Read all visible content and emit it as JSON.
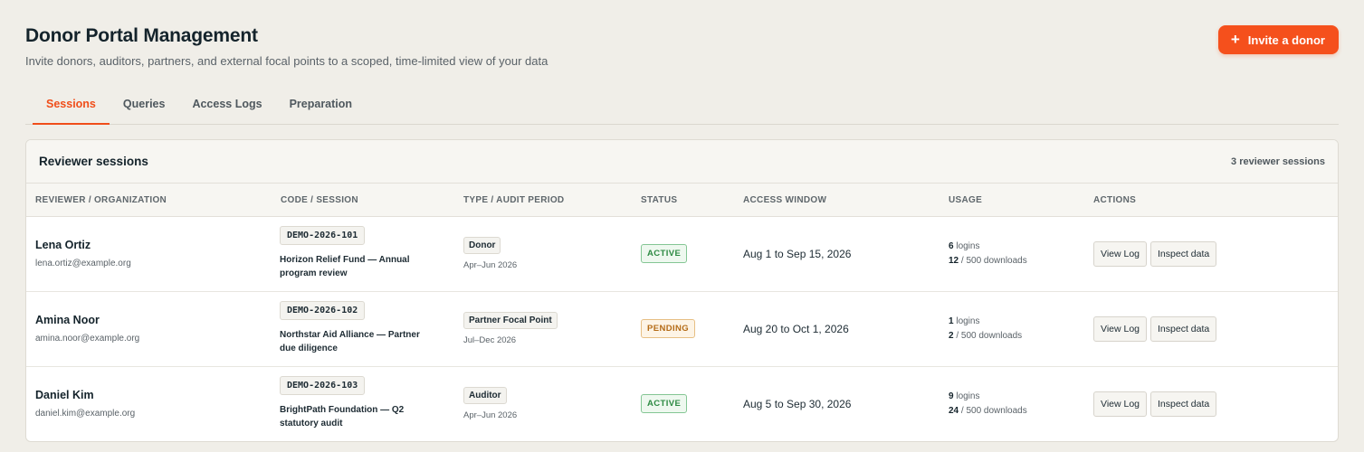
{
  "header": {
    "title": "Donor Portal Management",
    "subtitle": "Invite donors, auditors, partners, and external focal points to a scoped, time-limited view of your data",
    "invite_button": "Invite a donor",
    "invite_icon": "+"
  },
  "tabs": [
    {
      "label": "Sessions",
      "active": true
    },
    {
      "label": "Queries",
      "active": false
    },
    {
      "label": "Access Logs",
      "active": false
    },
    {
      "label": "Preparation",
      "active": false
    }
  ],
  "card": {
    "title": "Reviewer sessions",
    "count_text": "3 reviewer sessions"
  },
  "columns": {
    "reviewer": "REVIEWER / ORGANIZATION",
    "code": "CODE / SESSION",
    "type": "TYPE / AUDIT PERIOD",
    "status": "STATUS",
    "window": "ACCESS WINDOW",
    "usage": "USAGE",
    "actions": "ACTIONS"
  },
  "rows": [
    {
      "name": "Lena Ortiz",
      "email": "lena.ortiz@example.org",
      "code": "DEMO-2026-101",
      "session": "Horizon Relief Fund — Annual program review",
      "type": "Donor",
      "period": "Apr–Jun 2026",
      "status": "ACTIVE",
      "status_kind": "active",
      "window": "Aug 1 to Sep 15, 2026",
      "logins": "6",
      "logins_label": " logins",
      "downloads": "12",
      "downloads_label": " / 500 downloads",
      "action_view": "View Log",
      "action_inspect": "Inspect data"
    },
    {
      "name": "Amina Noor",
      "email": "amina.noor@example.org",
      "code": "DEMO-2026-102",
      "session": "Northstar Aid Alliance — Partner due diligence",
      "type": "Partner Focal Point",
      "period": "Jul–Dec 2026",
      "status": "PENDING",
      "status_kind": "pending",
      "window": "Aug 20 to Oct 1, 2026",
      "logins": "1",
      "logins_label": " logins",
      "downloads": "2",
      "downloads_label": " / 500 downloads",
      "action_view": "View Log",
      "action_inspect": "Inspect data"
    },
    {
      "name": "Daniel Kim",
      "email": "daniel.kim@example.org",
      "code": "DEMO-2026-103",
      "session": "BrightPath Foundation — Q2 statutory audit",
      "type": "Auditor",
      "period": "Apr–Jun 2026",
      "status": "ACTIVE",
      "status_kind": "active",
      "window": "Aug 5 to Sep 30, 2026",
      "logins": "9",
      "logins_label": " logins",
      "downloads": "24",
      "downloads_label": " / 500 downloads",
      "action_view": "View Log",
      "action_inspect": "Inspect data"
    }
  ],
  "colors": {
    "accent": "#f5501c",
    "active_tab": "#f04e1a",
    "status_active": "#2d8a43",
    "status_pending": "#b46b16",
    "background": "#f0eee8"
  }
}
